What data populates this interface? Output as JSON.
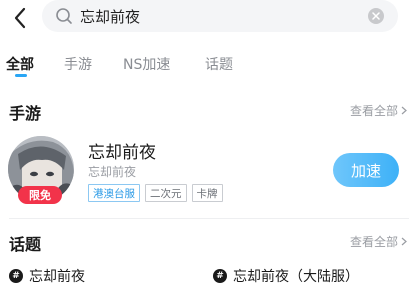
{
  "search": {
    "value": "忘却前夜"
  },
  "tabs": [
    {
      "label": "全部"
    },
    {
      "label": "手游"
    },
    {
      "label": "NS加速"
    },
    {
      "label": "话题"
    }
  ],
  "mobile_section": {
    "title": "手游",
    "see_all": "查看全部"
  },
  "game": {
    "name": "忘却前夜",
    "subtitle": "忘却前夜",
    "badge": "限免",
    "tags": [
      "港澳台服",
      "二次元",
      "卡牌"
    ],
    "action_label": "加速"
  },
  "topic_section": {
    "title": "话题",
    "see_all": "查看全部"
  },
  "topics": [
    {
      "label": "忘却前夜"
    },
    {
      "label": "忘却前夜（大陆服）"
    }
  ],
  "colors": {
    "accent": "#2aa6f5",
    "badge": "#f2334a"
  }
}
